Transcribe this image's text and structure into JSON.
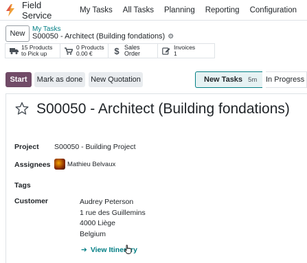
{
  "app": {
    "name": "Field Service",
    "accent": "#714b67",
    "link_color": "#017e84"
  },
  "menu": [
    "My Tasks",
    "All Tasks",
    "Planning",
    "Reporting",
    "Configuration"
  ],
  "control_panel": {
    "new_label": "New",
    "breadcrumb_parent": "My Tasks",
    "breadcrumb_current": "S00050 - Architect (Building fondations)"
  },
  "smart_buttons": [
    {
      "icon": "truck-icon",
      "line1": "15 Products",
      "line2": "to Pick up"
    },
    {
      "icon": "cart-icon",
      "line1": "0 Products",
      "line2": "0.00 €"
    },
    {
      "icon": "dollar-icon",
      "line1": "Sales Order",
      "line2": ""
    },
    {
      "icon": "edit-icon",
      "line1": "Invoices",
      "line2": "1"
    }
  ],
  "actions": {
    "start": "Start",
    "mark_done": "Mark as done",
    "new_quotation": "New Quotation"
  },
  "stages": {
    "current": "New Tasks",
    "current_time": "5m",
    "next": "In Progress"
  },
  "record": {
    "title": "S00050 - Architect (Building fondations)",
    "project_label": "Project",
    "project_value": "S00050 - Building Project",
    "assignees_label": "Assignees",
    "assignee_name": "Mathieu Belvaux",
    "tags_label": "Tags",
    "customer_label": "Customer",
    "customer_name": "Audrey Peterson",
    "customer_street": "1 rue des Guillemins",
    "customer_city": "4000 Liège",
    "customer_country": "Belgium",
    "view_itinerary": "View Itinerary"
  }
}
